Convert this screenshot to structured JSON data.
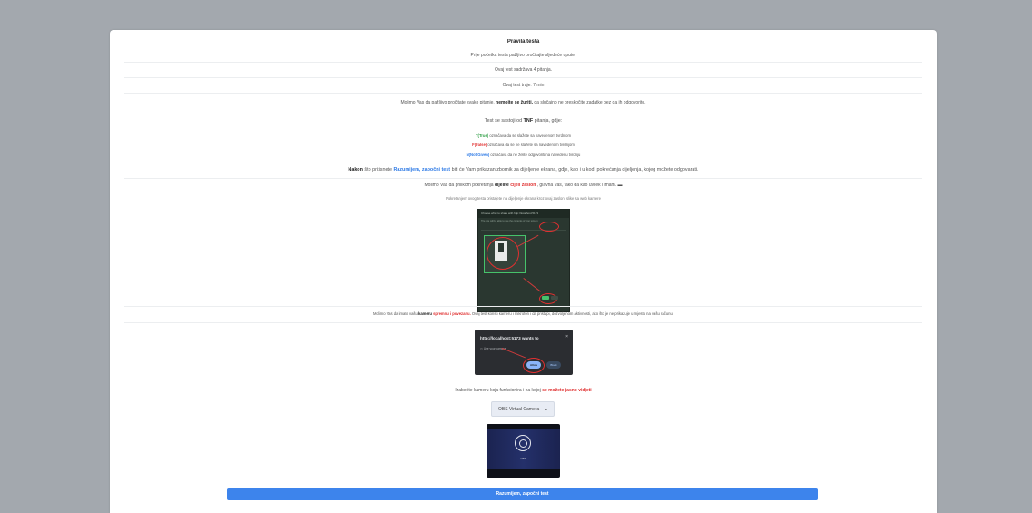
{
  "rules": {
    "title": "Pravila testa",
    "intro": "Prije početka testa pažljivo pročitajte sljedeće upute:",
    "question_count": "Ovaj test sadržava 4 pitanja.",
    "duration": "Ovaj test traje: 7 min",
    "read_carefully_pre": "Molimo Vas da pažljivo pročitate svako pitanje,",
    "read_carefully_bold": "nemojte se žuriti,",
    "read_carefully_post": "da slučajno ne preskočite zadatke bez da ih odgovorite.",
    "tnf_pre": "Test se sastoji od",
    "tnf_bold": "TNF",
    "tnf_post": "pitanja, gdje:",
    "tnf_t_key": "T(True)",
    "tnf_t_text": "označava da se slažete sa navedenom tvrdnjom",
    "tnf_f_key": "F(False)",
    "tnf_f_text": "označava da se ne slažete sa navedenom tvrdnjom",
    "tnf_n_key": "N(Not Given)",
    "tnf_n_text": "označava da ne želite odgovoriti na navedenu tvrdnju",
    "after_bold": "Nakon",
    "after_mid": "što pritisnete",
    "after_blue": "Razumijem, započni test",
    "after_post": "biti će Vam prikazan zbornik za dijeljenje ekrana, gdje, kao i u kod, pokrećanja dijeljenja, kojeg možete odgovarati.",
    "share_pre": "Molimo Vas da prilikom pokretanja",
    "share_bold": "dijelite",
    "share_red": "cijeli zaslon",
    "share_post": ", glavna Vas, tako da kao uvijek i imam. ▬",
    "share_hint": "Pokretanjem ovog testa pristajete na dijeljenje ekrana kroz ovaj zaslon, slike sa web kamere",
    "camera_pre": "Molimo Vas da imate vašu",
    "camera_bold": "kameru",
    "camera_red": "spremnu i povezanu.",
    "camera_post": "Ovaj test koristi kameru i mikrofon i da pristupi, dozvoljenom aktivnosti, ako što je ne prikazuje u mjestu na vašu računu.",
    "choose_pre": "Izaberite kameru koja funkcionira i na kojoj",
    "choose_red": "se možete jasno vidjeti"
  },
  "instruction_image": {
    "dialog_title": "Choose what to share with http://localhost:5173",
    "dialog_sub": "The site will be able to see the contents of your screen"
  },
  "permission_dialog": {
    "url": "http://localhost:5173 wants to",
    "close": "×",
    "camera_line": "Use your camera",
    "allow": "Allow",
    "block": "Block"
  },
  "camera_select": {
    "selected": "OBS Virtual Camera",
    "chevron": "⌄"
  },
  "camera_preview": {
    "label": "OBS"
  },
  "start_button": {
    "label": "Razumijem, započni test"
  }
}
